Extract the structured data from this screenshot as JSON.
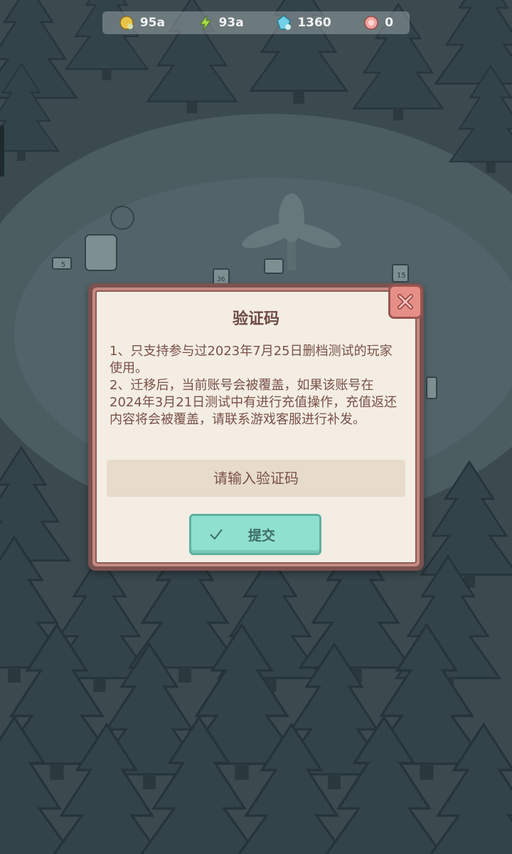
{
  "resources": [
    {
      "icon": "gold-coin-icon",
      "value": "95a"
    },
    {
      "icon": "energy-bolt-icon",
      "value": "93a"
    },
    {
      "icon": "diamond-gem-icon",
      "value": "1360"
    },
    {
      "icon": "pink-token-icon",
      "value": "0"
    }
  ],
  "scene": {
    "signs": [
      "5",
      "36",
      "15"
    ]
  },
  "dialog": {
    "title": "验证码",
    "body": [
      "1、只支持参与过2023年7月25日删档测试的玩家使用。",
      "2、迁移后，当前账号会被覆盖，如果该账号在2024年3月21日测试中有进行充值操作，充值返还内容将会被覆盖，请联系游戏客服进行补发。"
    ],
    "input_placeholder": "请输入验证码",
    "input_value": "",
    "submit_label": "提交"
  },
  "colors": {
    "overlay": "#3b4a4f",
    "dialog_border": "#7a5250",
    "paper": "#f3ede3",
    "text": "#7a5148",
    "submit": "#8fe0cf",
    "close": "#e58f88"
  }
}
